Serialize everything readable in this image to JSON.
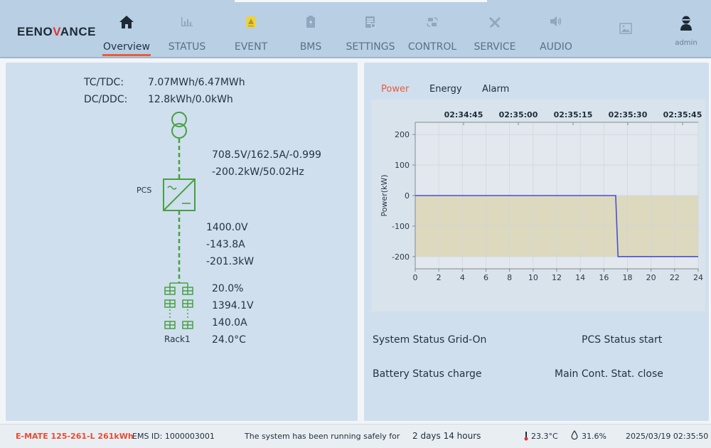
{
  "brand": {
    "logo_text_a": "EENO",
    "logo_text_v": "V",
    "logo_text_b": "ANCE"
  },
  "nav": {
    "items": [
      {
        "label": "Overview",
        "icon": "home-icon"
      },
      {
        "label": "STATUS",
        "icon": "bar-chart-icon"
      },
      {
        "label": "EVENT",
        "icon": "warning-document-icon"
      },
      {
        "label": "BMS",
        "icon": "battery-icon"
      },
      {
        "label": "SETTINGS",
        "icon": "settings-document-icon"
      },
      {
        "label": "CONTROL",
        "icon": "control-icon"
      },
      {
        "label": "SERVICE",
        "icon": "wrench-icon"
      },
      {
        "label": "AUDIO",
        "icon": "speaker-icon"
      },
      {
        "label": "",
        "icon": "image-icon"
      },
      {
        "label": "admin",
        "icon": "user-icon"
      }
    ],
    "active_index": 0
  },
  "overview": {
    "tc_tdc_label": "TC/TDC:",
    "tc_tdc_value": "7.07MWh/6.47MWh",
    "dc_ddc_label": "DC/DDC:",
    "dc_ddc_value": "12.8kWh/0.0kWh",
    "grid_line1": "708.5V/162.5A/-0.999",
    "grid_line2": "-200.2kW/50.02Hz",
    "pcs_label": "PCS",
    "dc_voltage": "1400.0V",
    "dc_current": "-143.8A",
    "dc_power": "-201.3kW",
    "rack_soc": "20.0%",
    "rack_voltage": "1394.1V",
    "rack_current": "140.0A",
    "rack_temp": "24.0°C",
    "rack_label": "Rack1"
  },
  "chart_tabs": {
    "items": [
      "Power",
      "Energy",
      "Alarm"
    ],
    "active_index": 0
  },
  "chart_data": {
    "type": "line",
    "ylabel": "Power(kW)",
    "xlabel": "",
    "x_ticks": [
      0,
      2,
      4,
      6,
      8,
      10,
      12,
      14,
      16,
      18,
      20,
      22,
      24
    ],
    "top_time_labels": [
      "02:34:45",
      "02:35:00",
      "02:35:15",
      "02:35:30",
      "02:35:45"
    ],
    "y_ticks": [
      200,
      100,
      0,
      -100,
      -200
    ],
    "xlim": [
      0,
      24
    ],
    "ylim": [
      -240,
      240
    ],
    "series": [
      {
        "x": [
          0,
          17,
          17.2,
          24
        ],
        "y": [
          0,
          0,
          -200,
          -200
        ]
      }
    ],
    "shaded_band": [
      -200,
      0
    ],
    "colors": {
      "line": "#4a4fd0",
      "band": "#ddd9bf"
    },
    "grid": true
  },
  "status": {
    "system_status": "System Status Grid-On",
    "pcs_status": "PCS Status start",
    "battery_status": "Battery Status charge",
    "main_cont": "Main Cont. Stat. close"
  },
  "footer": {
    "model": "E-MATE 125-261-L 261kWh",
    "ems_id": "EMS ID: 1000003001",
    "uptime_prefix": "The system has been running safely for",
    "uptime_value": "2 days 14 hours",
    "temperature": "23.3°C",
    "humidity": "31.6%",
    "datetime": "2025/03/19 02:35:50"
  }
}
